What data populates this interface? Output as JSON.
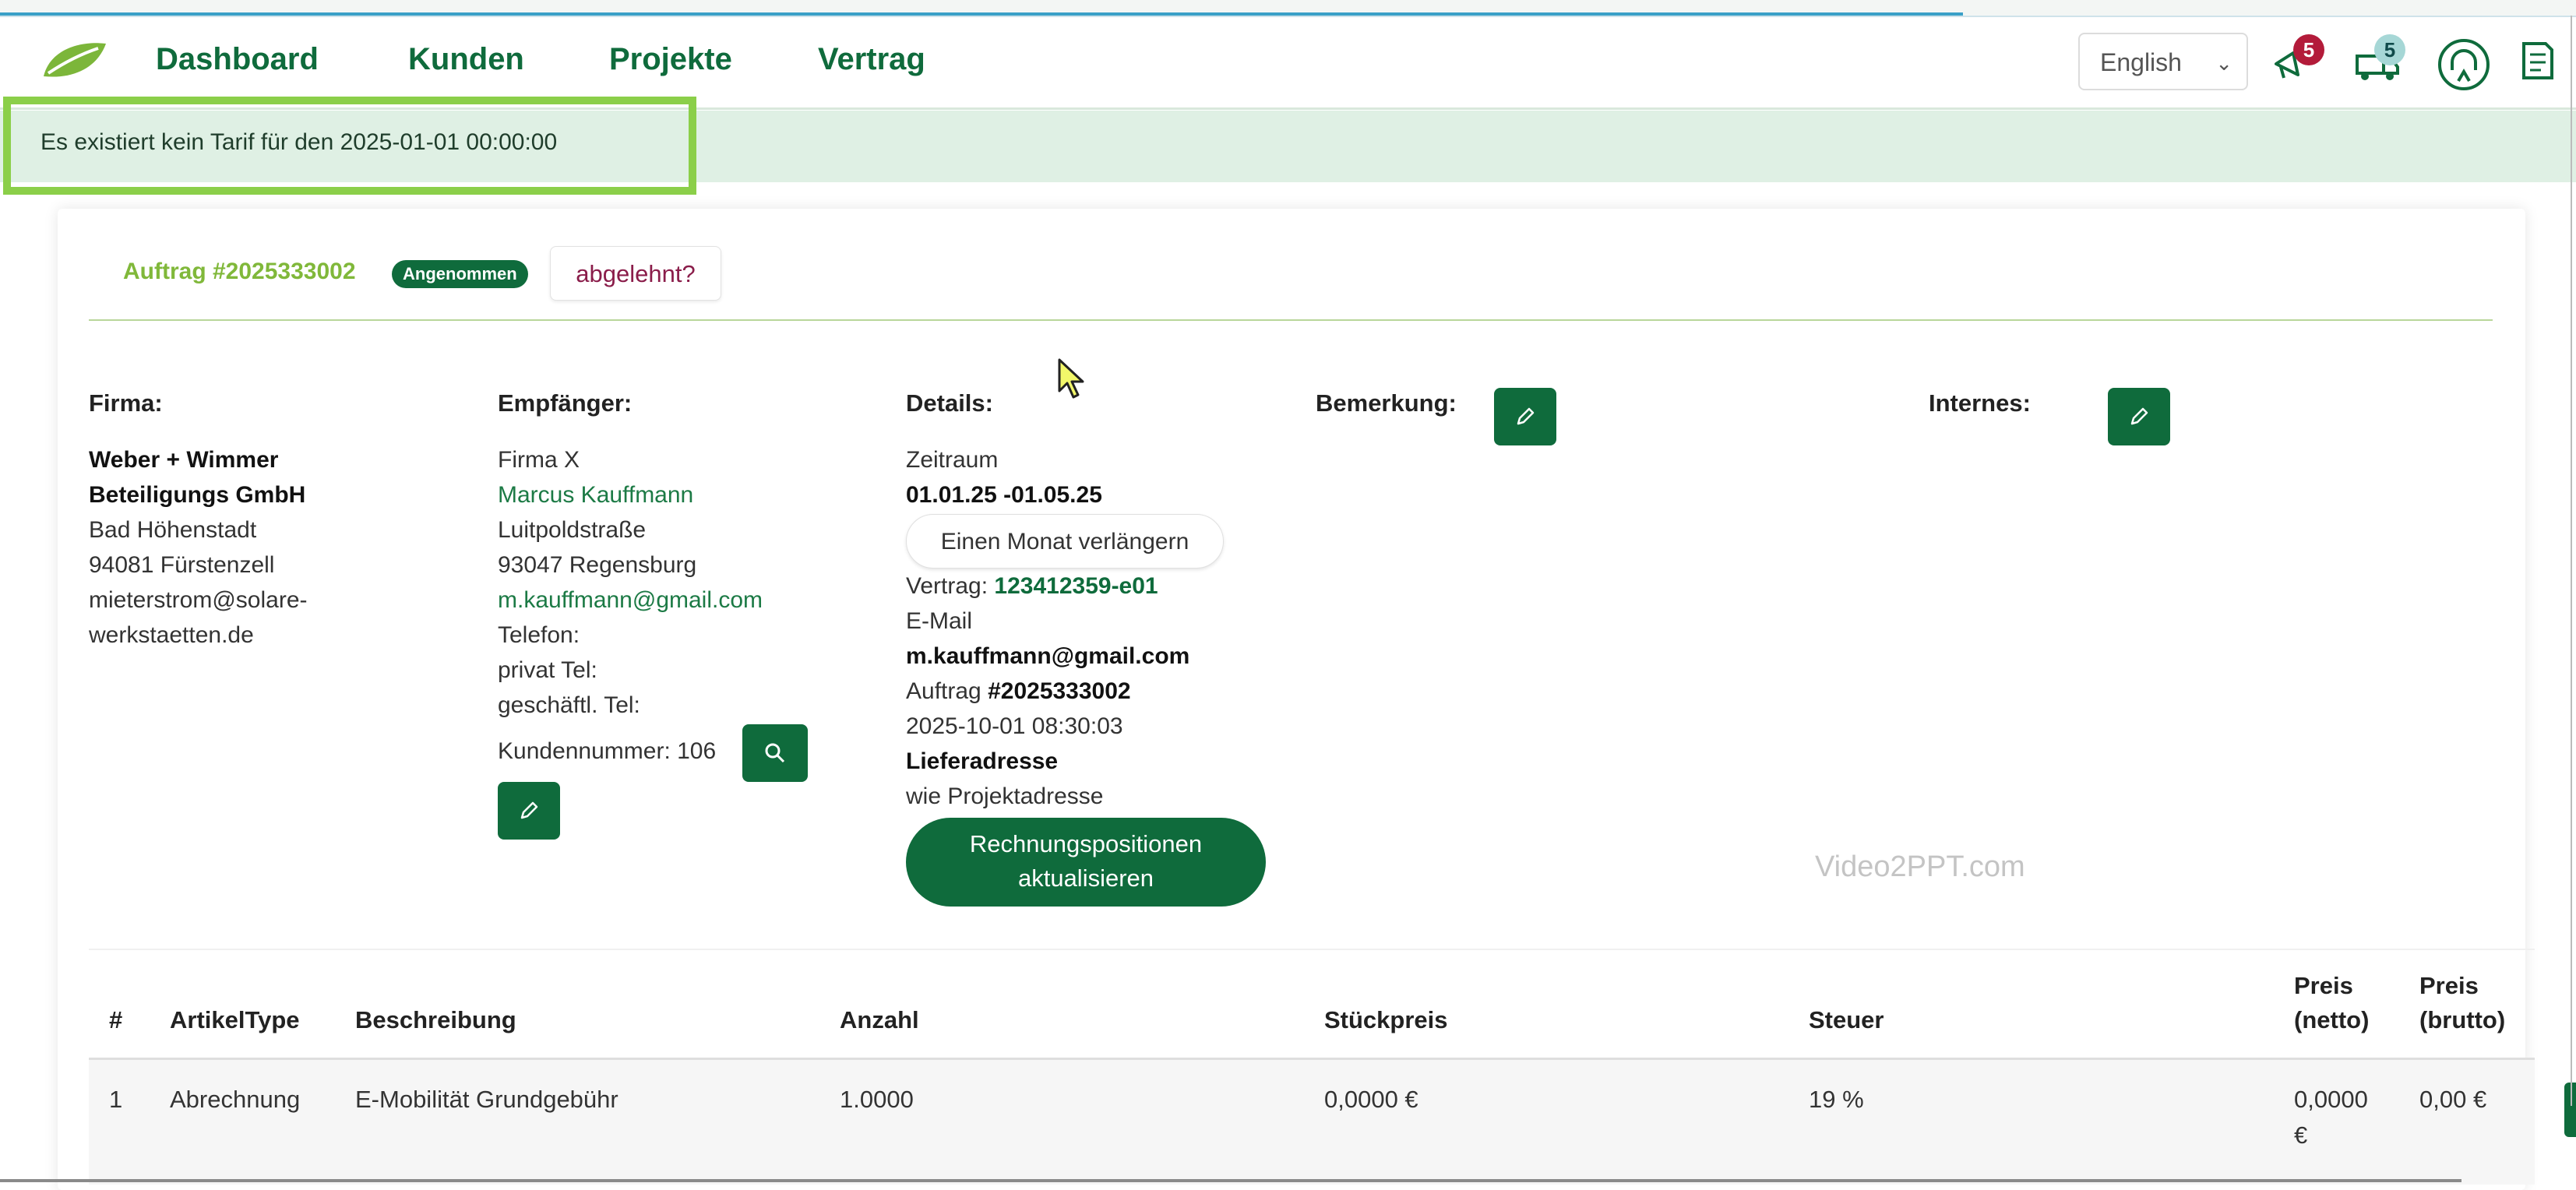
{
  "nav": {
    "items": [
      "Dashboard",
      "Kunden",
      "Projekte",
      "Vertrag"
    ],
    "language": "English",
    "notifications_count": "5",
    "deliveries_count": "5"
  },
  "alert": {
    "text": "Es existiert kein Tarif für den 2025-01-01 00:00:00"
  },
  "order": {
    "title": "Auftrag #2025333002",
    "status": "Angenommen",
    "reject_label": "abgelehnt?"
  },
  "firma": {
    "heading": "Firma:",
    "name_line1": "Weber + Wimmer",
    "name_line2": "Beteiligungs GmbH",
    "street": "Bad Höhenstadt",
    "city": "94081 Fürstenzell",
    "email_line1": "mieterstrom@solare-",
    "email_line2": "werkstaetten.de"
  },
  "empfaenger": {
    "heading": "Empfänger:",
    "company": "Firma X",
    "name": "Marcus Kauffmann",
    "street": "Luitpoldstraße",
    "city": "93047 Regensburg",
    "email": "m.kauffmann@gmail.com",
    "phone_label": "Telefon:",
    "private_label": "privat Tel:",
    "business_label": "geschäftl. Tel:",
    "customer_number": "Kundennummer: 106"
  },
  "details": {
    "heading": "Details:",
    "period_label": "Zeitraum",
    "period_value": "01.01.25 -01.05.25",
    "extend_label": "Einen Monat verlängern",
    "contract_label": "Vertrag:",
    "contract_value": "123412359-e01",
    "email_label": "E-Mail",
    "email_value": "m.kauffmann@gmail.com",
    "order_label": "Auftrag",
    "order_value": "#2025333002",
    "datetime": "2025-10-01 08:30:03",
    "delivery_label": "Lieferadresse",
    "delivery_value": "wie Projektadresse",
    "update_label_line1": "Rechnungspositionen",
    "update_label_line2": "aktualisieren"
  },
  "bemerkung": {
    "heading": "Bemerkung:"
  },
  "internes": {
    "heading": "Internes:"
  },
  "watermark": "Video2PPT.com",
  "table": {
    "headers": {
      "num": "#",
      "type": "ArtikelType",
      "desc": "Beschreibung",
      "qty": "Anzahl",
      "unit": "Stückpreis",
      "tax": "Steuer",
      "net_l1": "Preis",
      "net_l2": "(netto)",
      "gross_l1": "Preis",
      "gross_l2": "(brutto)"
    },
    "rows": [
      {
        "num": "1",
        "type": "Abrechnung",
        "desc": "E-Mobilität Grundgebühr",
        "qty": "1.0000",
        "unit": "0,0000 €",
        "tax": "19 %",
        "net_l1": "0,0000",
        "net_l2": "€",
        "gross": "0,00 €"
      }
    ]
  },
  "colors": {
    "brand_green": "#0f6b3c",
    "accent_lime": "#80b83a",
    "alert_bg": "#dff0e4",
    "highlight_frame": "#8bcf49"
  }
}
